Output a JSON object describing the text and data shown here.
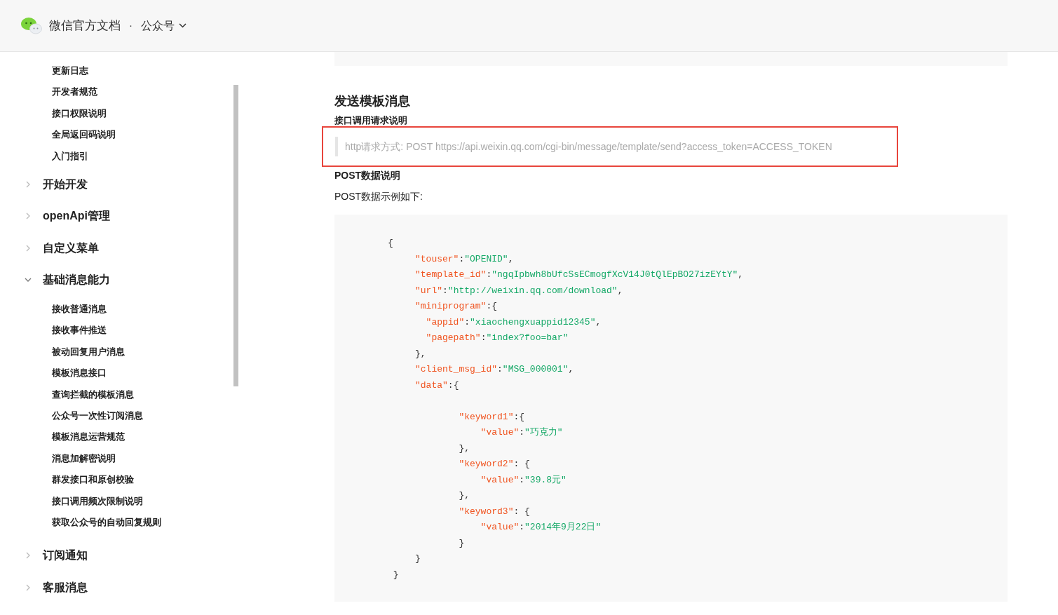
{
  "header": {
    "title": "微信官方文档",
    "separator": "·",
    "section": "公众号"
  },
  "sidebar": {
    "leading_items": [
      "更新日志",
      "开发者规范",
      "接口权限说明",
      "全局返回码说明",
      "入门指引"
    ],
    "groups": [
      {
        "label": "开始开发",
        "expanded": false
      },
      {
        "label": "openApi管理",
        "expanded": false
      },
      {
        "label": "自定义菜单",
        "expanded": false
      },
      {
        "label": "基础消息能力",
        "expanded": true,
        "children": [
          "接收普通消息",
          "接收事件推送",
          "被动回复用户消息",
          "模板消息接口",
          "查询拦截的模板消息",
          "公众号一次性订阅消息",
          "模板消息运营规范",
          "消息加解密说明",
          "群发接口和原创校验",
          "接口调用频次限制说明",
          "获取公众号的自动回复规则"
        ]
      },
      {
        "label": "订阅通知",
        "expanded": false
      },
      {
        "label": "客服消息",
        "expanded": false
      }
    ]
  },
  "content": {
    "heading": "发送模板消息",
    "request_label": "接口调用请求说明",
    "request_note": "http请求方式: POST https://api.weixin.qq.com/cgi-bin/message/template/send?access_token=ACCESS_TOKEN",
    "post_label": "POST数据说明",
    "example_label": "POST数据示例如下:",
    "code_lines": [
      {
        "kind": "code",
        "parts": [
          {
            "kind": "punct",
            "text": "{"
          }
        ]
      },
      {
        "kind": "code",
        "parts": [
          {
            "kind": "key",
            "text": "     \"touser\""
          },
          {
            "kind": "punct",
            "text": ":"
          },
          {
            "kind": "str",
            "text": "\"OPENID\""
          },
          {
            "kind": "punct",
            "text": ","
          }
        ]
      },
      {
        "kind": "code",
        "parts": [
          {
            "kind": "key",
            "text": "     \"template_id\""
          },
          {
            "kind": "punct",
            "text": ":"
          },
          {
            "kind": "str",
            "text": "\"ngqIpbwh8bUfcSsECmogfXcV14J0tQlEpBO27izEYtY\""
          },
          {
            "kind": "punct",
            "text": ","
          }
        ]
      },
      {
        "kind": "code",
        "parts": [
          {
            "kind": "key",
            "text": "     \"url\""
          },
          {
            "kind": "punct",
            "text": ":"
          },
          {
            "kind": "str",
            "text": "\"http://weixin.qq.com/download\""
          },
          {
            "kind": "punct",
            "text": ","
          }
        ]
      },
      {
        "kind": "code",
        "parts": [
          {
            "kind": "key",
            "text": "     \"miniprogram\""
          },
          {
            "kind": "punct",
            "text": ":{"
          }
        ]
      },
      {
        "kind": "code",
        "parts": [
          {
            "kind": "key",
            "text": "       \"appid\""
          },
          {
            "kind": "punct",
            "text": ":"
          },
          {
            "kind": "str",
            "text": "\"xiaochengxuappid12345\""
          },
          {
            "kind": "punct",
            "text": ","
          }
        ]
      },
      {
        "kind": "code",
        "parts": [
          {
            "kind": "key",
            "text": "       \"pagepath\""
          },
          {
            "kind": "punct",
            "text": ":"
          },
          {
            "kind": "str",
            "text": "\"index?foo=bar\""
          }
        ]
      },
      {
        "kind": "code",
        "parts": [
          {
            "kind": "punct",
            "text": "     },"
          }
        ]
      },
      {
        "kind": "code",
        "parts": [
          {
            "kind": "key",
            "text": "     \"client_msg_id\""
          },
          {
            "kind": "punct",
            "text": ":"
          },
          {
            "kind": "str",
            "text": "\"MSG_000001\""
          },
          {
            "kind": "punct",
            "text": ","
          }
        ]
      },
      {
        "kind": "code",
        "parts": [
          {
            "kind": "key",
            "text": "     \"data\""
          },
          {
            "kind": "punct",
            "text": ":{"
          }
        ]
      },
      {
        "kind": "blank"
      },
      {
        "kind": "code",
        "parts": [
          {
            "kind": "key",
            "text": "             \"keyword1\""
          },
          {
            "kind": "punct",
            "text": ":{"
          }
        ]
      },
      {
        "kind": "code",
        "parts": [
          {
            "kind": "key",
            "text": "                 \"value\""
          },
          {
            "kind": "punct",
            "text": ":"
          },
          {
            "kind": "str",
            "text": "\"巧克力\""
          }
        ]
      },
      {
        "kind": "code",
        "parts": [
          {
            "kind": "punct",
            "text": "             },"
          }
        ]
      },
      {
        "kind": "code",
        "parts": [
          {
            "kind": "key",
            "text": "             \"keyword2\""
          },
          {
            "kind": "punct",
            "text": ": {"
          }
        ]
      },
      {
        "kind": "code",
        "parts": [
          {
            "kind": "key",
            "text": "                 \"value\""
          },
          {
            "kind": "punct",
            "text": ":"
          },
          {
            "kind": "str",
            "text": "\"39.8元\""
          }
        ]
      },
      {
        "kind": "code",
        "parts": [
          {
            "kind": "punct",
            "text": "             },"
          }
        ]
      },
      {
        "kind": "code",
        "parts": [
          {
            "kind": "key",
            "text": "             \"keyword3\""
          },
          {
            "kind": "punct",
            "text": ": {"
          }
        ]
      },
      {
        "kind": "code",
        "parts": [
          {
            "kind": "key",
            "text": "                 \"value\""
          },
          {
            "kind": "punct",
            "text": ":"
          },
          {
            "kind": "str",
            "text": "\"2014年9月22日\""
          }
        ]
      },
      {
        "kind": "code",
        "parts": [
          {
            "kind": "punct",
            "text": "             }"
          }
        ]
      },
      {
        "kind": "code",
        "parts": [
          {
            "kind": "punct",
            "text": "     }"
          }
        ]
      },
      {
        "kind": "code",
        "parts": [
          {
            "kind": "punct",
            "text": " }"
          }
        ]
      }
    ]
  }
}
